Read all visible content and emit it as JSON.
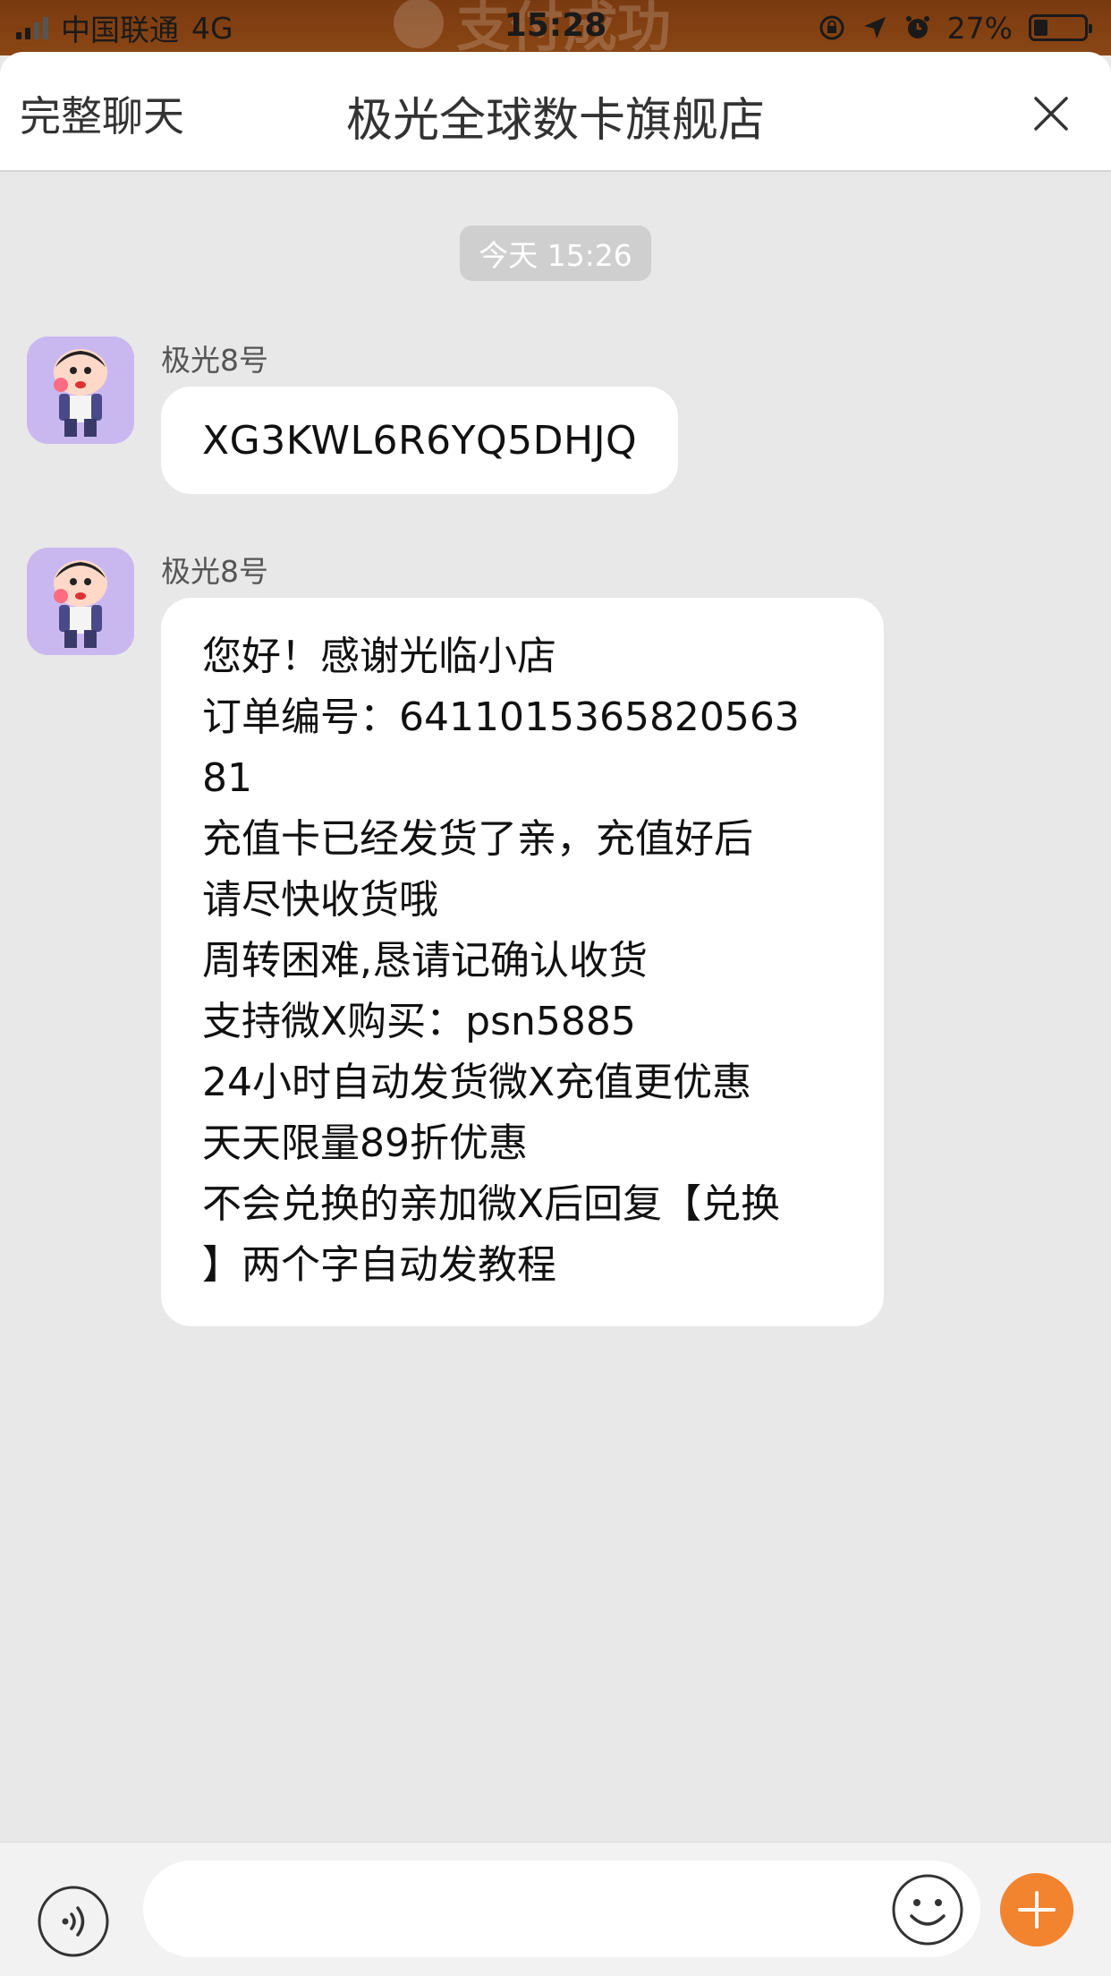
{
  "status_bar": {
    "carrier": "中国联通",
    "network": "4G",
    "time": "15:28",
    "battery_text": "27%",
    "battery_level": 0.27,
    "background_text": "支付成功"
  },
  "header": {
    "full_chat_label": "完整聊天",
    "title": "极光全球数卡旗舰店",
    "close_icon": "close-icon"
  },
  "chat": {
    "timestamp": "今天 15:26",
    "messages": [
      {
        "sender": "极光8号",
        "text": "XG3KWL6R6YQ5DHJQ"
      },
      {
        "sender": "极光8号",
        "lines": [
          "您好！感谢光临小店",
          "订单编号：6411015365820563\n81",
          "充值卡已经发货了亲，充值好后\n请尽快收货哦",
          "周转困难,恳请记确认收货",
          "支持微X购买：psn5885",
          "24小时自动发货微X充值更优惠",
          "天天限量89折优惠",
          "不会兑换的亲加微X后回复【兑换\n】两个字自动发教程"
        ]
      }
    ]
  },
  "input_bar": {
    "placeholder": "",
    "voice_icon": "voice-icon",
    "emoji_icon": "emoji-icon",
    "plus_icon": "plus-icon"
  },
  "colors": {
    "accent": "#f2832f",
    "avatar_bg": "#c9b8f0",
    "chat_bg": "#e8e8e8"
  }
}
